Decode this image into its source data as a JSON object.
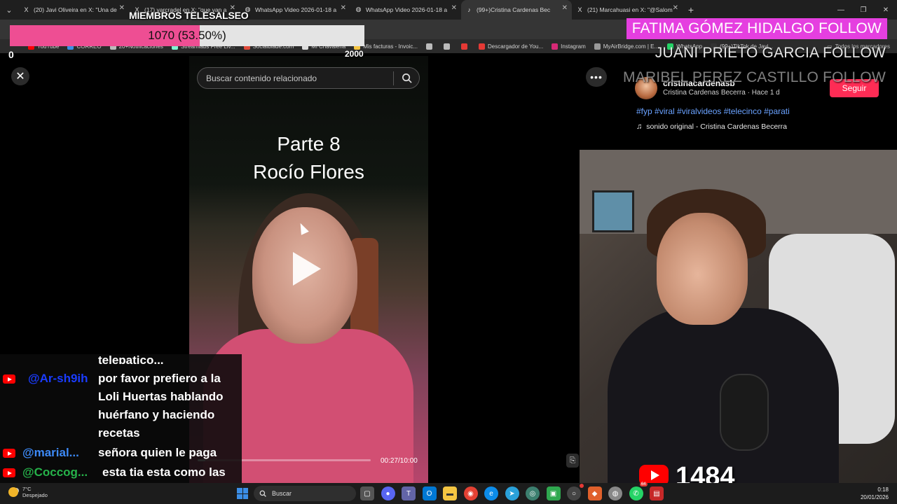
{
  "browser": {
    "tabs": [
      {
        "label": "(20) Javi Oliveira en X: \"Una de",
        "icon": "x-logo-icon"
      },
      {
        "label": "(17) varcradel en X: \"que van a",
        "icon": "x-logo-icon"
      },
      {
        "label": "WhatsApp Video 2026-01-18 a",
        "icon": "globe-icon"
      },
      {
        "label": "WhatsApp Video 2026-01-18 a",
        "icon": "globe-icon"
      },
      {
        "label": "(99+)Cristina Cardenas Bec",
        "icon": "tiktok-icon",
        "active": true
      },
      {
        "label": "(21) Marcahuasi en X: \"@Salom",
        "icon": "x-logo-icon"
      }
    ],
    "bookmarks": [
      {
        "label": "YouTube",
        "color": "#ff0000"
      },
      {
        "label": "CORREO",
        "color": "#3a8ee6"
      },
      {
        "label": "20+Notificaciones",
        "color": "#bbbbbb"
      },
      {
        "label": "Streamlabs Free Liv...",
        "color": "#80f5d2"
      },
      {
        "label": "Socialblade.com",
        "color": "#e14b3b"
      },
      {
        "label": "Mi Chavaleria",
        "color": "#dddddd"
      },
      {
        "label": "Mis facturas - Invoic...",
        "color": "#f5c542"
      },
      {
        "label": "",
        "color": "#bbbbbb"
      },
      {
        "label": "",
        "color": "#bbbbbb"
      },
      {
        "label": "",
        "color": "#e53935"
      },
      {
        "label": "Descargador de You...",
        "color": "#e53935"
      },
      {
        "label": "Instagram",
        "color": "#d62976"
      },
      {
        "label": "MyAirBridge.com | E...",
        "color": "#999999"
      },
      {
        "label": "WhatsApp",
        "color": "#25d366"
      },
      {
        "label": "(99+)TikTok de Javi...",
        "color": "#333333"
      }
    ],
    "bookmarks_right": "Todos los marcadores"
  },
  "overlay": {
    "members_title": "MIEMBROS TELESALSEO",
    "goal_text": "1070 (53.50%)",
    "goal_fraction": 0.535,
    "goal_min": "0",
    "goal_max": "2000",
    "follows": [
      "FATIMA GÓMEZ HIDALGO  FOLLOW",
      "JUANI PRIETO GARCIA  FOLLOW",
      "MARIBEL PEREZ CASTILLO  FOLLOW"
    ],
    "accent_color": "#ee4e93"
  },
  "tiktok": {
    "search_placeholder": "Buscar contenido relacionado",
    "video_title_line1": "Parte 8",
    "video_title_line2": "Rocío Flores",
    "time": "00:27/10:00",
    "progress_fraction": 0.045,
    "author_handle": "cristinacardenasb",
    "author_meta": "Cristina Cardenas Becerra · Hace 1 d",
    "follow_label": "Seguir",
    "hashtags": "#fyp #viral #viralvideos #telecinco #parati",
    "sound": "sonido original - Cristina Cardenas Becerra",
    "brand_color": "#fe2c55"
  },
  "live": {
    "viewers": "1484"
  },
  "chat": [
    {
      "user": "",
      "msg": "telepatico..."
    },
    {
      "user": "@Ar-sh9ih",
      "user_color": "#1a3cff",
      "msg": "por favor prefiero a la Loli Huertas hablando huérfano y haciendo recetas"
    },
    {
      "user": "@marial...",
      "user_color": "#3d8af7",
      "msg": "señora quien le paga"
    },
    {
      "user": "@Coccog...",
      "user_color": "#26b34a",
      "msg": "esta tia esta como las maracas de machin"
    }
  ],
  "taskbar": {
    "weather_temp": "7°C",
    "weather_desc": "Despejado",
    "search_label": "Buscar",
    "time": "0:18",
    "date": "20/01/2026",
    "notification_badge": "64"
  }
}
